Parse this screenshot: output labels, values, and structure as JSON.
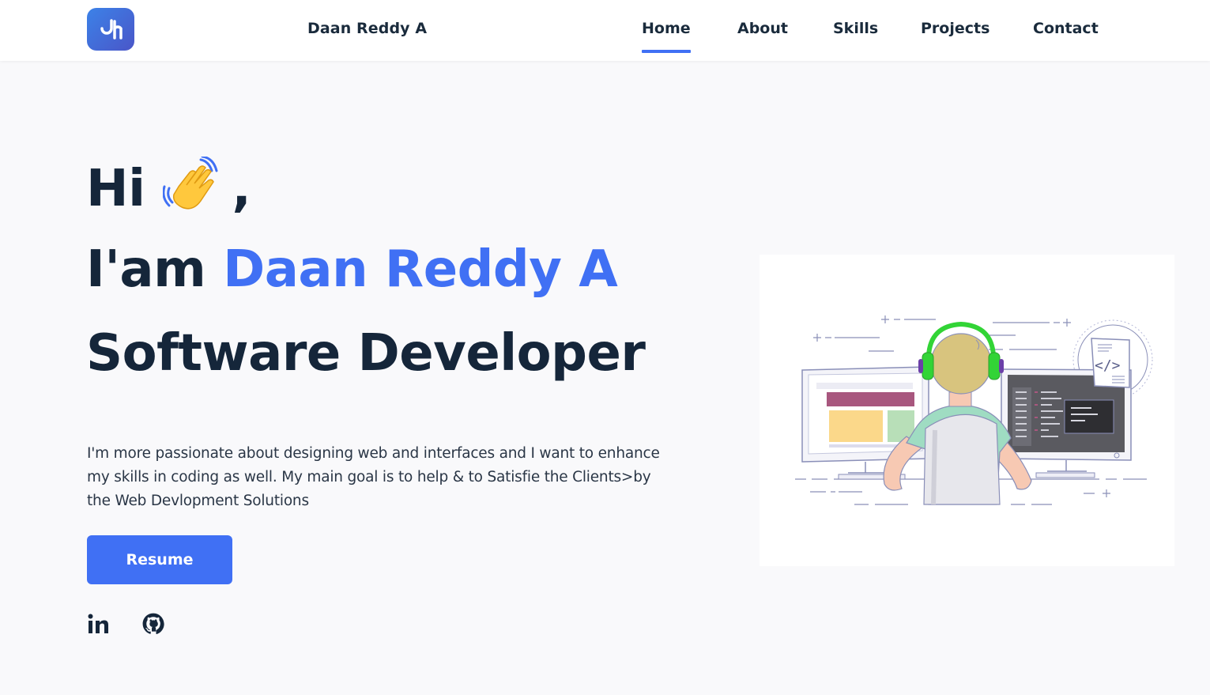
{
  "header": {
    "logo_icon": "logo-dh-icon",
    "brand_name": "Daan Reddy A",
    "nav": [
      {
        "label": "Home",
        "active": true
      },
      {
        "label": "About",
        "active": false
      },
      {
        "label": "Skills",
        "active": false
      },
      {
        "label": "Projects",
        "active": false
      },
      {
        "label": "Contact",
        "active": false
      }
    ]
  },
  "hero": {
    "greeting": "Hi",
    "greeting_suffix": ",",
    "wave_icon": "waving-hand-icon",
    "intro_prefix": "I'am",
    "name": "Daan Reddy A",
    "title": "Software Developer",
    "description": "I'm more passionate about designing web and interfaces and I want to enhance my skills in coding as well. My main goal is to help & to Satisfie the Clients>by the Web Devlopment Solutions",
    "resume_label": "Resume",
    "socials": [
      {
        "icon": "linkedin-icon"
      },
      {
        "icon": "github-icon"
      }
    ],
    "illustration": "developer-at-desk-illustration"
  },
  "colors": {
    "accent": "#4070f4",
    "text_dark": "#15263a",
    "background": "#f9f9fb"
  }
}
